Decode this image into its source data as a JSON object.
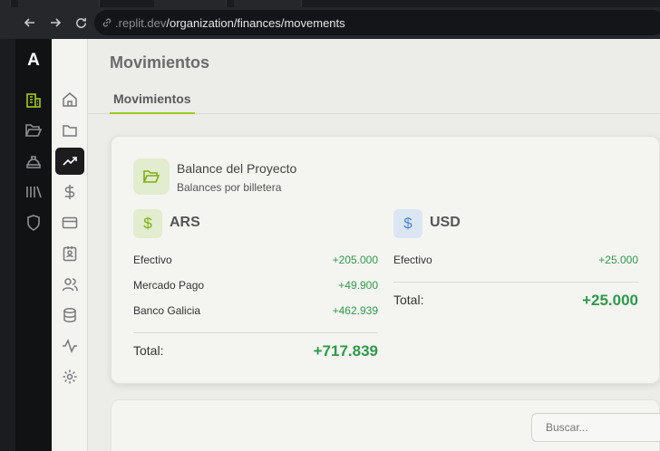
{
  "browser": {
    "url_prefix": ".replit.dev",
    "url_path": "/organization/finances/movements"
  },
  "rail": {
    "logo": "A",
    "icons": [
      "building-icon",
      "folder-open-icon",
      "helmet-icon",
      "library-icon",
      "shield-icon"
    ]
  },
  "iconbar": {
    "items": [
      "home-icon",
      "folder-icon",
      "trending-icon",
      "dollar-icon",
      "card-icon",
      "badge-icon",
      "users-icon",
      "database-icon",
      "activity-icon",
      "settings-icon"
    ],
    "active": "trending-icon"
  },
  "page": {
    "title": "Movimientos",
    "tab": "Movimientos"
  },
  "balance": {
    "title": "Balance del Proyecto",
    "subtitle": "Balances por billetera",
    "wallets": [
      {
        "currency": "ARS",
        "rows": [
          {
            "label": "Efectivo",
            "value": "+205.000"
          },
          {
            "label": "Mercado Pago",
            "value": "+49.900"
          },
          {
            "label": "Banco Galicia",
            "value": "+462.939"
          }
        ],
        "total_label": "Total:",
        "total": "+717.839"
      },
      {
        "currency": "USD",
        "rows": [
          {
            "label": "Efectivo",
            "value": "+25.000"
          }
        ],
        "total_label": "Total:",
        "total": "+25.000"
      }
    ]
  },
  "search": {
    "placeholder": "Buscar..."
  },
  "colors": {
    "accent": "#9bc91a",
    "positive": "#2e9a4a",
    "rail_bg": "#111213"
  }
}
